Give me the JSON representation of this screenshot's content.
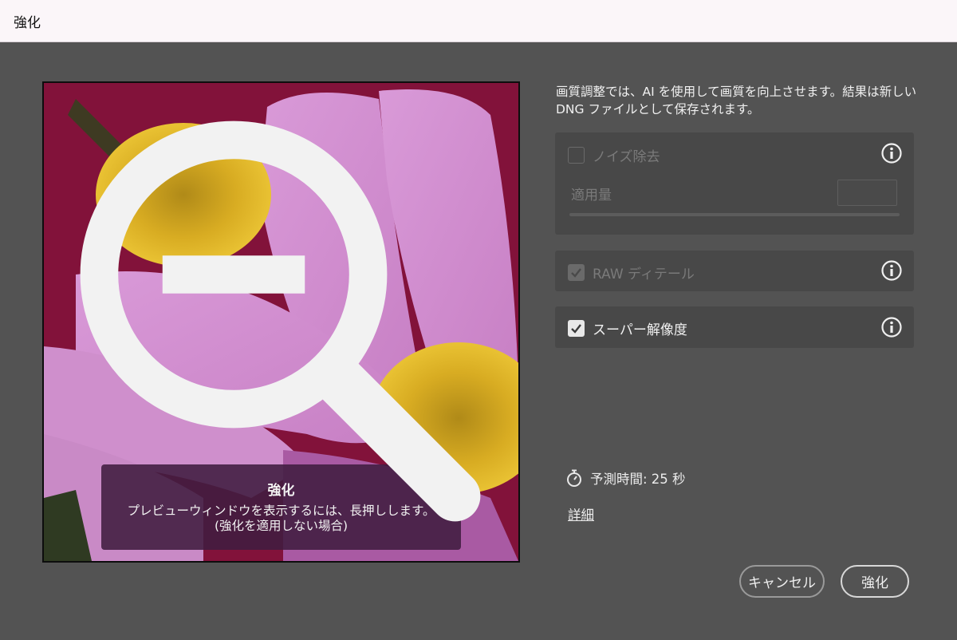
{
  "window": {
    "title": "強化"
  },
  "preview": {
    "tooltip_title": "強化",
    "tooltip_line1": "プレビューウィンドウを表示するには、長押しします。",
    "tooltip_line2": "(強化を適用しない場合)",
    "zoom_icon": "zoom-out-icon"
  },
  "description": "画質調整では、AI を使用して画質を向上させます。結果は新しい DNG ファイルとして保存されます。",
  "options": {
    "denoise": {
      "label": "ノイズ除去",
      "checked": false,
      "enabled": false,
      "amount_label": "適用量",
      "amount_value": ""
    },
    "raw_details": {
      "label": "RAW ディテール",
      "checked": true,
      "enabled": false
    },
    "super_resolution": {
      "label": "スーパー解像度",
      "checked": true,
      "enabled": true
    }
  },
  "estimate": {
    "label": "予測時間: 25 秒",
    "icon": "stopwatch-icon"
  },
  "details_link": "詳細",
  "buttons": {
    "cancel": "キャンセル",
    "enhance": "強化"
  },
  "colors": {
    "background": "#535353",
    "panel": "#484848",
    "titlebar": "#fbf6f9"
  }
}
